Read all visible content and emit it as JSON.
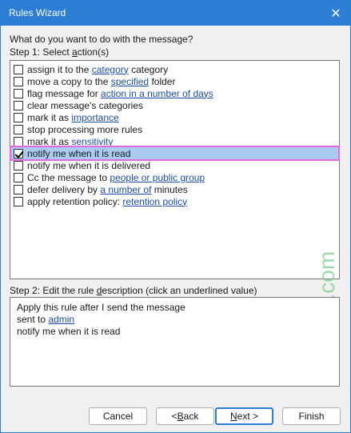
{
  "window": {
    "title": "Rules Wizard",
    "close_glyph": "✕"
  },
  "prompt": "What do you want to do with the message?",
  "step1": {
    "prefix": "Step 1: Select ",
    "accel": "a",
    "suffix": "ction(s)"
  },
  "actions": [
    {
      "before": "assign it to the ",
      "link": "category",
      "after": " category",
      "checked": false
    },
    {
      "before": "move a copy to the ",
      "link": "specified",
      "after": " folder",
      "checked": false
    },
    {
      "before": "flag message for ",
      "link": "action in a number of days",
      "after": "",
      "checked": false
    },
    {
      "before": "clear message's categories",
      "link": "",
      "after": "",
      "checked": false
    },
    {
      "before": "mark it as ",
      "link": "importance",
      "after": "",
      "checked": false
    },
    {
      "before": "stop processing more rules",
      "link": "",
      "after": "",
      "checked": false
    },
    {
      "before": "mark it as ",
      "link": "sensitivity",
      "after": "",
      "checked": false
    },
    {
      "before": "notify me when it is read",
      "link": "",
      "after": "",
      "checked": true
    },
    {
      "before": "notify me when it is delivered",
      "link": "",
      "after": "",
      "checked": false
    },
    {
      "before": "Cc the message to ",
      "link": "people or public group",
      "after": "",
      "checked": false
    },
    {
      "before": "defer delivery by ",
      "link": "a number of",
      "after": " minutes",
      "checked": false
    },
    {
      "before": "apply retention policy: ",
      "link": "retention policy",
      "after": "",
      "checked": false
    }
  ],
  "step2": {
    "prefix": "Step 2: Edit the rule ",
    "accel": "d",
    "suffix": "escription (click an underlined value)"
  },
  "description": {
    "line1": "Apply this rule after I send the message",
    "line2_before": "sent to ",
    "line2_link": "admin",
    "line3": "notify me when it is read"
  },
  "buttons": {
    "cancel": "Cancel",
    "back_prefix": "< ",
    "back_accel": "B",
    "back_suffix": "ack",
    "next_accel": "N",
    "next_suffix": "ext >",
    "finish": "Finish"
  },
  "watermark": "Ablebits.com",
  "colors": {
    "titlebar": "#2b7ed4",
    "selection": "#a9cbef",
    "highlight_outline": "#e86ae0",
    "link": "#1b4fa5",
    "watermark": "#7fcf8a"
  }
}
